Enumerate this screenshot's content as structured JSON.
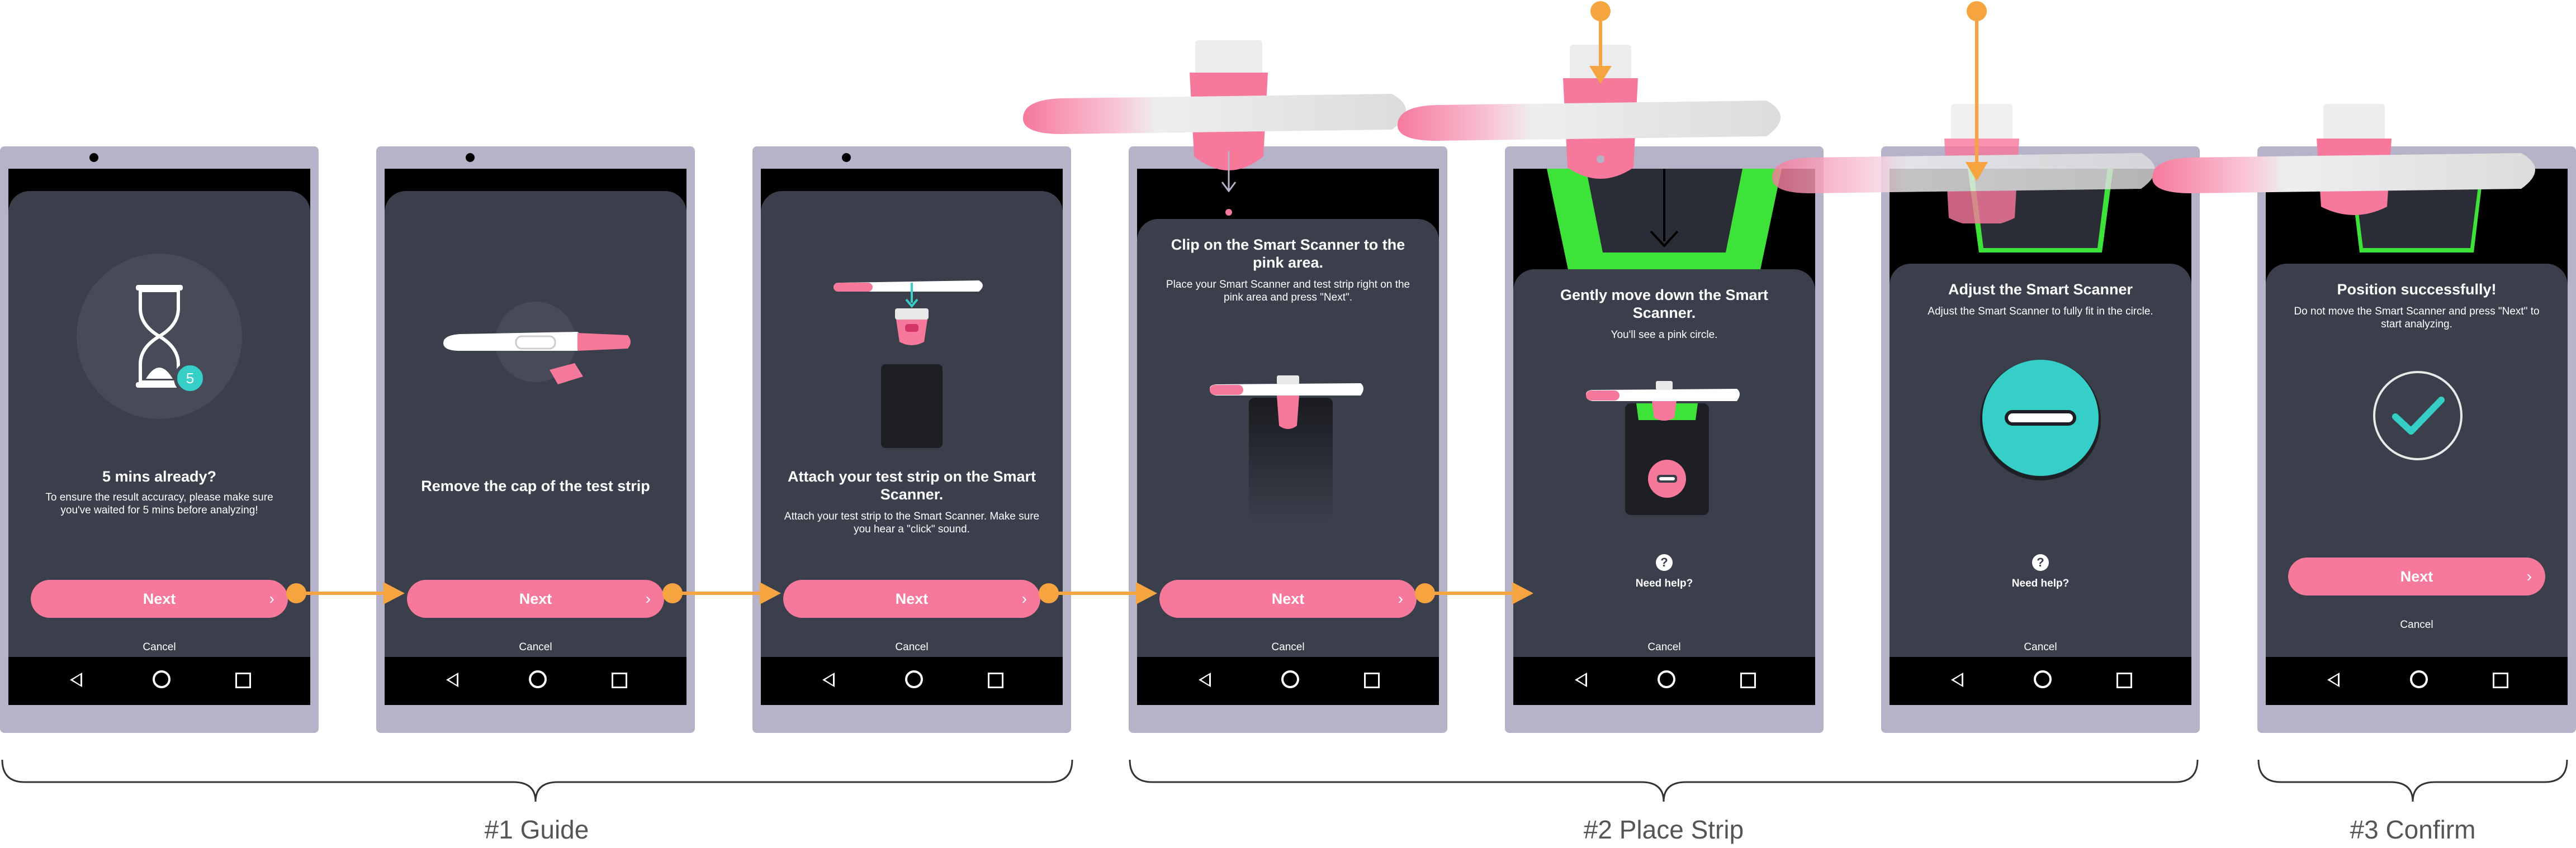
{
  "screens": [
    {
      "title": "5 mins already?",
      "body": "To ensure the result accuracy, please make sure you've waited for 5 mins before analyzing!",
      "timer_badge": "5",
      "next": "Next",
      "cancel": "Cancel"
    },
    {
      "title": "Remove the cap of the test strip",
      "next": "Next",
      "cancel": "Cancel"
    },
    {
      "title": "Attach your test strip on the Smart Scanner.",
      "body": "Attach your test strip to the Smart Scanner. Make sure you hear a \"click\" sound.",
      "next": "Next",
      "cancel": "Cancel"
    },
    {
      "title": "Clip on the Smart Scanner to the pink area.",
      "body": "Place your Smart Scanner and test strip right on the pink area and press \"Next\".",
      "next": "Next",
      "cancel": "Cancel"
    },
    {
      "title": "Gently move down the Smart Scanner.",
      "body": "You'll see a pink circle.",
      "help_icon": "?",
      "help": "Need help?",
      "cancel": "Cancel"
    },
    {
      "title": "Adjust the Smart Scanner",
      "body": "Adjust the Smart Scanner to fully fit in the circle.",
      "help_icon": "?",
      "help": "Need help?",
      "cancel": "Cancel"
    },
    {
      "title": "Position successfully!",
      "body": "Do not move the Smart Scanner and press \"Next\" to start analyzing.",
      "next": "Next",
      "cancel": "Cancel"
    }
  ],
  "sections": [
    {
      "label": "#1 Guide"
    },
    {
      "label": "#2 Place Strip"
    },
    {
      "label": "#3 Confirm"
    }
  ],
  "colors": {
    "accent": "#f6799c",
    "flow": "#f5a440",
    "card": "#3b3e4b",
    "frame": "#b6b2c8",
    "success": "#35cfc8",
    "highlight": "#3ee339"
  },
  "icons": [
    "hourglass-icon",
    "test-strip-icon",
    "smart-scanner-icon",
    "checkmark-icon",
    "back-nav-icon",
    "home-nav-icon",
    "recent-apps-icon",
    "chevron-right-icon"
  ]
}
